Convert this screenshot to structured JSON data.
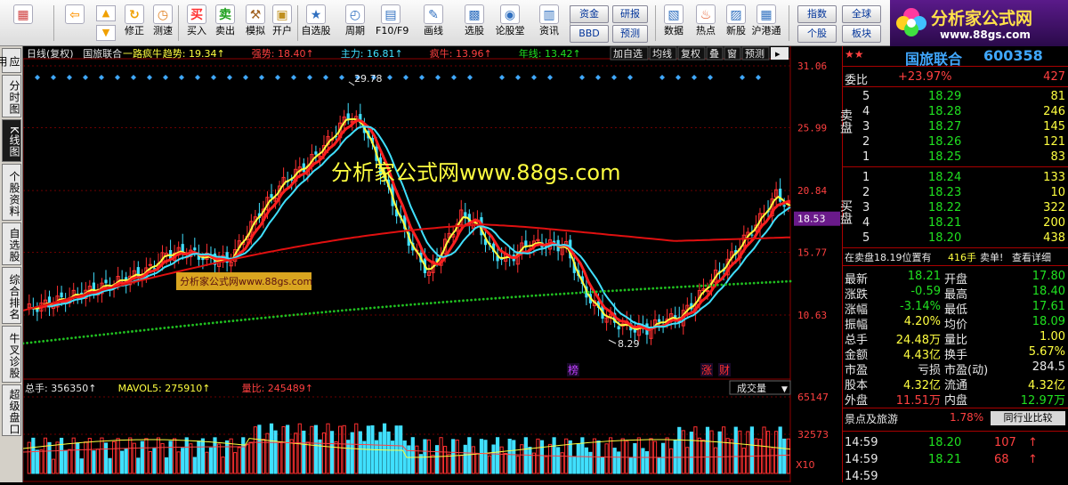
{
  "toolbar": {
    "buttons": [
      {
        "label": "",
        "icon": "grid-icon"
      },
      {
        "label": "",
        "icon": "back-arrow-icon"
      },
      {
        "label": "修正",
        "icon": "refresh-icon"
      },
      {
        "label": "测速",
        "icon": "clock-icon"
      },
      {
        "label": "买入",
        "icon": "buy-icon"
      },
      {
        "label": "卖出",
        "icon": "sell-icon"
      },
      {
        "label": "模拟",
        "icon": "hammer-icon"
      },
      {
        "label": "开户",
        "icon": "lock-icon"
      },
      {
        "label": "自选股",
        "icon": "star-icon"
      },
      {
        "label": "周期",
        "icon": "clock-cycle-icon"
      },
      {
        "label": "F10/F9",
        "icon": "f10-icon"
      },
      {
        "label": "画线",
        "icon": "pen-icon"
      },
      {
        "label": "选股",
        "icon": "screen-icon"
      },
      {
        "label": "论股堂",
        "icon": "forum-icon"
      },
      {
        "label": "资讯",
        "icon": "news-icon"
      },
      {
        "label": "数据",
        "icon": "pe-icon"
      },
      {
        "label": "热点",
        "icon": "hot-icon"
      },
      {
        "label": "新股",
        "icon": "newstock-icon"
      },
      {
        "label": "沪港通",
        "icon": "hk-icon"
      }
    ],
    "small": [
      "资金",
      "BBD",
      "研报",
      "预测",
      "指数",
      "个股",
      "全球",
      "板块"
    ],
    "buy_glyph": "买",
    "sell_glyph": "卖",
    "f10_glyph": "F10",
    "bbd_small": "BBD"
  },
  "logo": {
    "title": "分析家公式网",
    "url": "www.88gs.com"
  },
  "left_tabs": [
    "应用",
    "分时图",
    "K线图",
    "个股资料",
    "自选股",
    "综合排名",
    "牛叉诊股",
    "超级盘口"
  ],
  "chart": {
    "indicator_line": [
      {
        "text": "日线(复权)",
        "color": "#e8e8e8"
      },
      {
        "text": "国旅联合",
        "color": "#e8e8e8"
      },
      {
        "text": "一路疯牛",
        "color": "#ffff40"
      },
      {
        "text": "趋势: 19.34↑",
        "color": "#ffff40"
      },
      {
        "text": "强势: 18.40↑",
        "color": "#ff4040"
      },
      {
        "text": "主力: 16.81↑",
        "color": "#40e0ff"
      },
      {
        "text": "疯牛: 13.96↑",
        "color": "#ff4040"
      },
      {
        "text": "年线: 13.42↑",
        "color": "#20e020"
      }
    ],
    "top_buttons": [
      "加自选",
      "均线",
      "复权",
      "叠",
      "窗",
      "预测"
    ],
    "price_axis": [
      "31.06",
      "25.99",
      "20.84",
      "15.77",
      "10.63"
    ],
    "current_price": "18.53",
    "high_label": "29.78",
    "low_label": "8.29",
    "watermark": "分析家公式网www.88gs.com",
    "small_watermark": "分析家公式网www.88gs.com",
    "markers": [
      "榜",
      "涨",
      "财"
    ],
    "volume_line": [
      {
        "text": "总手: 356350↑",
        "color": "#e8e8e8"
      },
      {
        "text": "MAVOL5: 275910↑",
        "color": "#ffff40"
      },
      {
        "text": "量比: 245489↑",
        "color": "#ff4040"
      }
    ],
    "volume_selector": "成交量",
    "volume_axis": [
      "65147",
      "32573"
    ],
    "volume_unit": "X10"
  },
  "quote": {
    "name": "国旅联合",
    "code": "600358",
    "weibi": {
      "label": "委比",
      "pct": "+23.97%",
      "diff": "427"
    },
    "sell_label": "卖盘",
    "buy_label": "买盘",
    "sell": [
      {
        "lv": "5",
        "price": "18.29",
        "vol": "81"
      },
      {
        "lv": "4",
        "price": "18.28",
        "vol": "246"
      },
      {
        "lv": "3",
        "price": "18.27",
        "vol": "145"
      },
      {
        "lv": "2",
        "price": "18.26",
        "vol": "121"
      },
      {
        "lv": "1",
        "price": "18.25",
        "vol": "83"
      }
    ],
    "buy": [
      {
        "lv": "1",
        "price": "18.24",
        "vol": "133"
      },
      {
        "lv": "2",
        "price": "18.23",
        "vol": "10"
      },
      {
        "lv": "3",
        "price": "18.22",
        "vol": "322"
      },
      {
        "lv": "4",
        "price": "18.21",
        "vol": "200"
      },
      {
        "lv": "5",
        "price": "18.20",
        "vol": "438"
      }
    ],
    "status": {
      "text": "在卖盘18.19位置有",
      "hand": "416手",
      "alert": "卖单!",
      "link": "查看详细"
    },
    "stats": [
      {
        "l1": "最新",
        "v1": "18.21",
        "c1": "grn",
        "l2": "开盘",
        "v2": "17.80",
        "c2": "grn"
      },
      {
        "l1": "涨跌",
        "v1": "-0.59",
        "c1": "grn",
        "l2": "最高",
        "v2": "18.40",
        "c2": "grn"
      },
      {
        "l1": "涨幅",
        "v1": "-3.14%",
        "c1": "grn",
        "l2": "最低",
        "v2": "17.61",
        "c2": "grn"
      },
      {
        "l1": "振幅",
        "v1": "4.20%",
        "c1": "yel",
        "l2": "均价",
        "v2": "18.09",
        "c2": "grn"
      },
      {
        "l1": "总手",
        "v1": "24.48万",
        "c1": "yel",
        "l2": "量比",
        "v2": "1.00",
        "c2": "yel"
      },
      {
        "l1": "金额",
        "v1": "4.43亿",
        "c1": "yel",
        "l2": "换手",
        "v2": "5.67%",
        "c2": "yel"
      },
      {
        "l1": "市盈",
        "v1": "亏损",
        "c1": "wht",
        "l2": "市盈(动)",
        "v2": "284.5",
        "c2": "wht"
      },
      {
        "l1": "股本",
        "v1": "4.32亿",
        "c1": "yel",
        "l2": "流通",
        "v2": "4.32亿",
        "c2": "yel"
      },
      {
        "l1": "外盘",
        "v1": "11.51万",
        "c1": "red",
        "l2": "内盘",
        "v2": "12.97万",
        "c2": "grn"
      }
    ],
    "industry": {
      "name": "景点及旅游",
      "pct": "1.78%",
      "link": "同行业比较"
    },
    "ticks": [
      {
        "time": "14:59",
        "price": "18.20",
        "vol": "107",
        "dir": "↑"
      },
      {
        "time": "14:59",
        "price": "18.21",
        "vol": "68",
        "dir": "↑"
      },
      {
        "time": "14:59",
        "price": "",
        "vol": "",
        "dir": ""
      }
    ]
  }
}
